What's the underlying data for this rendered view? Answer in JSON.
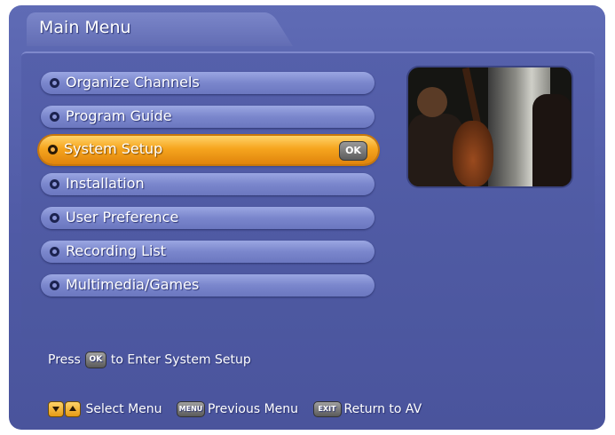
{
  "header": {
    "title": "Main Menu"
  },
  "menu": {
    "items": [
      {
        "label": "Organize Channels",
        "selected": false
      },
      {
        "label": "Program Guide",
        "selected": false
      },
      {
        "label": "System Setup",
        "selected": true,
        "badge": "OK"
      },
      {
        "label": "Installation",
        "selected": false
      },
      {
        "label": "User Preference",
        "selected": false
      },
      {
        "label": "Recording List",
        "selected": false
      },
      {
        "label": "Multimedia/Games",
        "selected": false
      }
    ]
  },
  "hint": {
    "prefix": "Press",
    "key": "OK",
    "suffix": "to Enter System Setup"
  },
  "footer": {
    "select_label": "Select Menu",
    "menu_key": "MENU",
    "previous_label": "Previous Menu",
    "exit_key": "EXIT",
    "return_label": "Return to AV"
  },
  "colors": {
    "background": "#5560ab",
    "menu_item": "#7a86cc",
    "selected_item": "#f6a51e",
    "text": "#ffffff"
  },
  "icons": [
    "bullet-icon",
    "ok-key-icon",
    "down-arrow-key-icon",
    "up-arrow-key-icon",
    "menu-key-icon",
    "exit-key-icon"
  ]
}
